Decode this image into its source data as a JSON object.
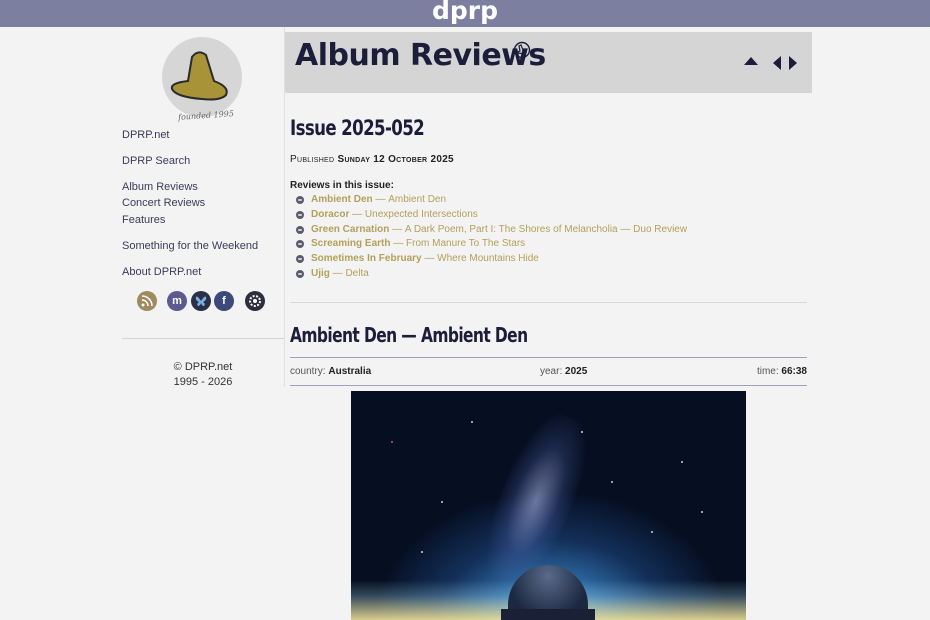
{
  "site": {
    "logo": "dprp"
  },
  "sidebar": {
    "founded": "founded 1995",
    "links": [
      {
        "label": "DPRP.net"
      },
      {
        "label": "DPRP Search"
      },
      {
        "label": "Album Reviews"
      },
      {
        "label": "Concert Reviews"
      },
      {
        "label": "Features"
      },
      {
        "label": "Something for the Weekend"
      },
      {
        "label": "About DPRP.net"
      }
    ],
    "social_icons": [
      "rss-icon",
      "mastodon-icon",
      "bluesky-icon",
      "facebook-icon",
      "settings-icon"
    ],
    "copyright_line1": "© DPRP.net",
    "copyright_line2": "1995 - 2026"
  },
  "header": {
    "title": "Album Reviews",
    "nav_icons": [
      "up-arrow-icon",
      "prev-arrow-icon",
      "next-arrow-icon"
    ]
  },
  "issue": {
    "title": "Issue 2025-052",
    "published_label": "Published",
    "published_date": "Sunday 12 October 2025",
    "reviews_label": "Reviews in this issue:",
    "reviews": [
      {
        "artist": "Ambient Den",
        "title": "Ambient Den"
      },
      {
        "artist": "Doracor",
        "title": "Unexpected Intersections"
      },
      {
        "artist": "Green Carnation",
        "title": "A Dark Poem, Part I: The Shores of Melancholia — Duo Review"
      },
      {
        "artist": "Screaming Earth",
        "title": "From Manure To The Stars"
      },
      {
        "artist": "Sometimes In February",
        "title": "Where Mountains Hide"
      },
      {
        "artist": "Ujig",
        "title": "Delta"
      }
    ]
  },
  "review": {
    "heading": "Ambient Den — Ambient Den",
    "country_label": "country:",
    "country": "Australia",
    "year_label": "year:",
    "year": "2025",
    "time_label": "time:",
    "time": "66:38"
  },
  "colors": {
    "topbar": "#7d7fa0",
    "link_gold": "#b3a05a",
    "heading_navy": "#1b1d3a",
    "header_bg": "#d5d5d5"
  }
}
